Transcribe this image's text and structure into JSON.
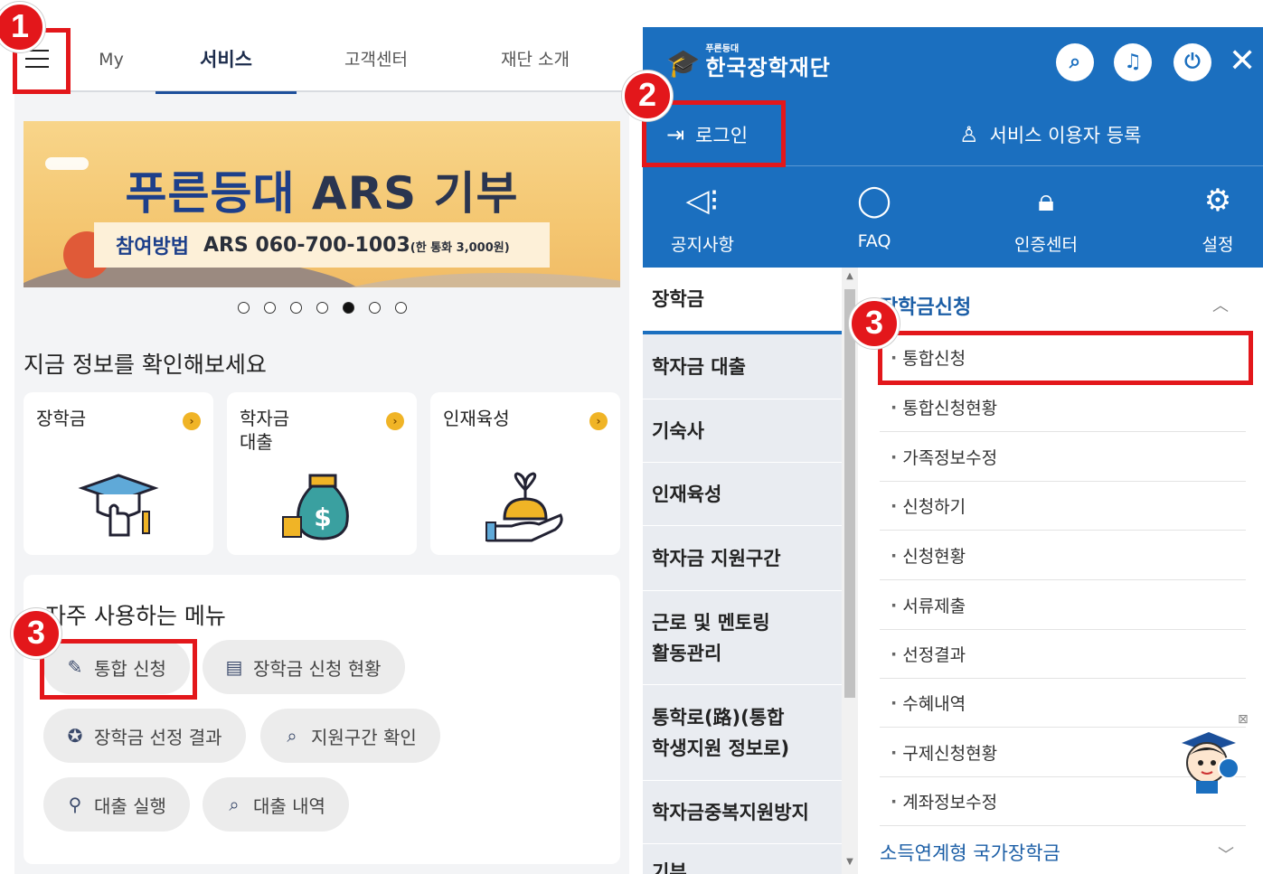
{
  "left": {
    "nav_tabs": [
      {
        "label": "My"
      },
      {
        "label": "서비스"
      },
      {
        "label": "고객센터"
      },
      {
        "label": "재단 소개"
      }
    ],
    "banner": {
      "title_a": "푸른등대",
      "title_b": "ARS 기부",
      "method_label": "참여방법",
      "method_value": "ARS 060-700-1003",
      "method_note": "(한 통화 3,000원)",
      "slide_count": 7,
      "active_slide": 5
    },
    "info_title": "지금 정보를 확인해보세요",
    "cards": [
      {
        "label": "장학금",
        "icon": "graduation-cap-hand-icon"
      },
      {
        "label": "학자금\n대출",
        "icon": "money-bag-icon"
      },
      {
        "label": "인재육성",
        "icon": "sprout-hand-icon"
      }
    ],
    "frequent_title": "자주 사용하는 메뉴",
    "frequent_menu": [
      {
        "label": "통합 신청",
        "icon": "apply-icon"
      },
      {
        "label": "장학금 신청 현황",
        "icon": "document-icon"
      },
      {
        "label": "장학금 선정 결과",
        "icon": "award-icon"
      },
      {
        "label": "지원구간 확인",
        "icon": "magnify-doc-icon"
      },
      {
        "label": "대출 실행",
        "icon": "search-person-icon"
      },
      {
        "label": "대출 내역",
        "icon": "magnify-doc-icon"
      }
    ]
  },
  "right": {
    "logo_small": "푸른등대",
    "logo_big": "한국장학재단",
    "header_icons": [
      "search-icon",
      "bell-icon",
      "power-icon",
      "close-icon"
    ],
    "login_label": "로그인",
    "register_label": "서비스 이용자 등록",
    "quick_menu": [
      {
        "label": "공지사항",
        "icon": "megaphone-icon"
      },
      {
        "label": "FAQ",
        "icon": "chat-bubble-icon"
      },
      {
        "label": "인증센터",
        "icon": "lock-icon"
      },
      {
        "label": "설정",
        "icon": "gear-icon"
      }
    ],
    "categories": [
      {
        "label": "장학금"
      },
      {
        "label": "학자금 대출"
      },
      {
        "label": "기숙사"
      },
      {
        "label": "인재육성"
      },
      {
        "label": "학자금 지원구간"
      },
      {
        "label": "근로 및 멘토링\n활동관리"
      },
      {
        "label": "통학로(路)(통합\n학생지원 정보로)"
      },
      {
        "label": "학자금중복지원방지"
      },
      {
        "label": "기부"
      }
    ],
    "submenu_title": "장학금신청",
    "submenu_items": [
      {
        "label": "통합신청"
      },
      {
        "label": "통합신청현황"
      },
      {
        "label": "가족정보수정"
      },
      {
        "label": "신청하기"
      },
      {
        "label": "신청현황"
      },
      {
        "label": "서류제출"
      },
      {
        "label": "선정결과"
      },
      {
        "label": "수혜내역"
      },
      {
        "label": "구제신청현황"
      },
      {
        "label": "계좌정보수정"
      }
    ],
    "footer_item": "소득연계형 국가장학금"
  },
  "annotations": {
    "badge_1": "1",
    "badge_2": "2",
    "badge_3a": "3",
    "badge_3b": "3",
    "highlight_color": "#e3171b"
  },
  "colors": {
    "brand_blue": "#1b6fbf",
    "nav_active": "#1d4f9b"
  }
}
